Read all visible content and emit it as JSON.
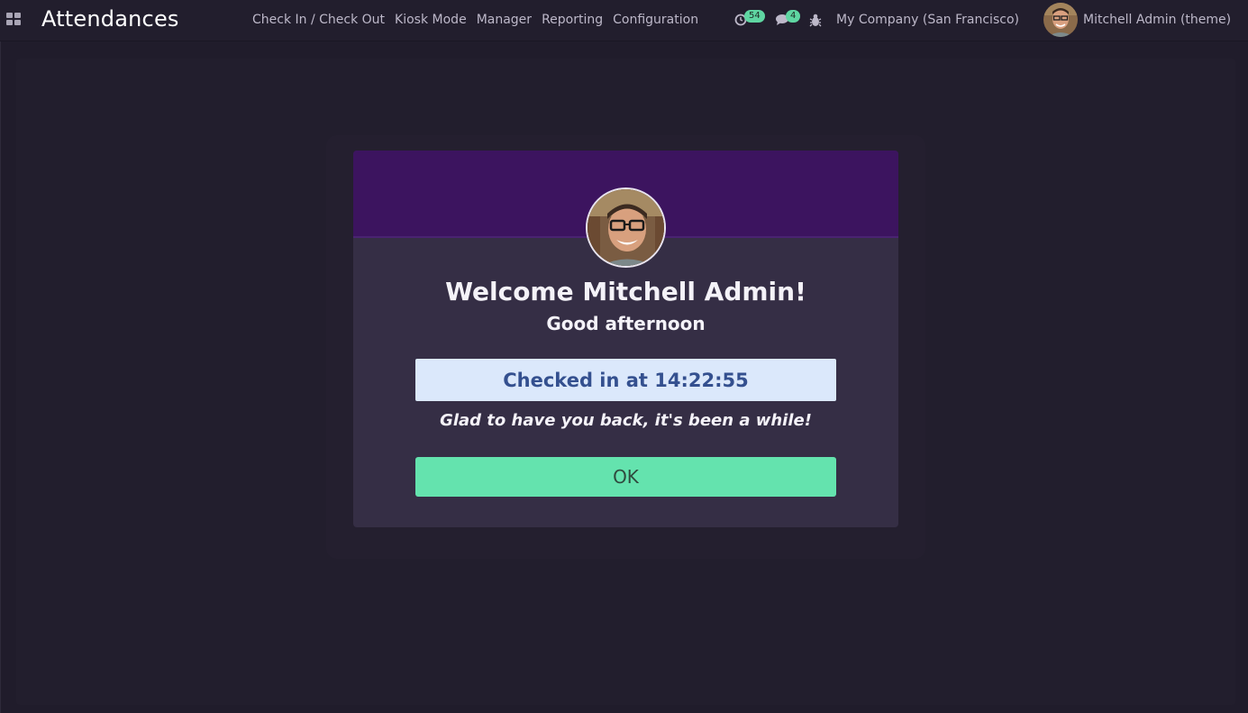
{
  "navbar": {
    "app_title": "Attendances",
    "menu": [
      {
        "label": "Check In / Check Out"
      },
      {
        "label": "Kiosk Mode"
      },
      {
        "label": "Manager"
      },
      {
        "label": "Reporting"
      },
      {
        "label": "Configuration"
      }
    ],
    "activity_count": "54",
    "message_count": "4",
    "company": "My Company (San Francisco)",
    "user": "Mitchell Admin (theme)"
  },
  "dialog": {
    "welcome": "Welcome Mitchell Admin!",
    "greeting": "Good afternoon",
    "checked_in": "Checked in at 14:22:55",
    "message": "Glad to have you back, it's been a while!",
    "ok_label": "OK"
  },
  "colors": {
    "header_purple": "#3c145f",
    "ok_green": "#64e3ae",
    "badge_green": "#5fd6a2",
    "status_blue_bg": "#dbe8fb",
    "status_blue_text": "#34508f"
  }
}
